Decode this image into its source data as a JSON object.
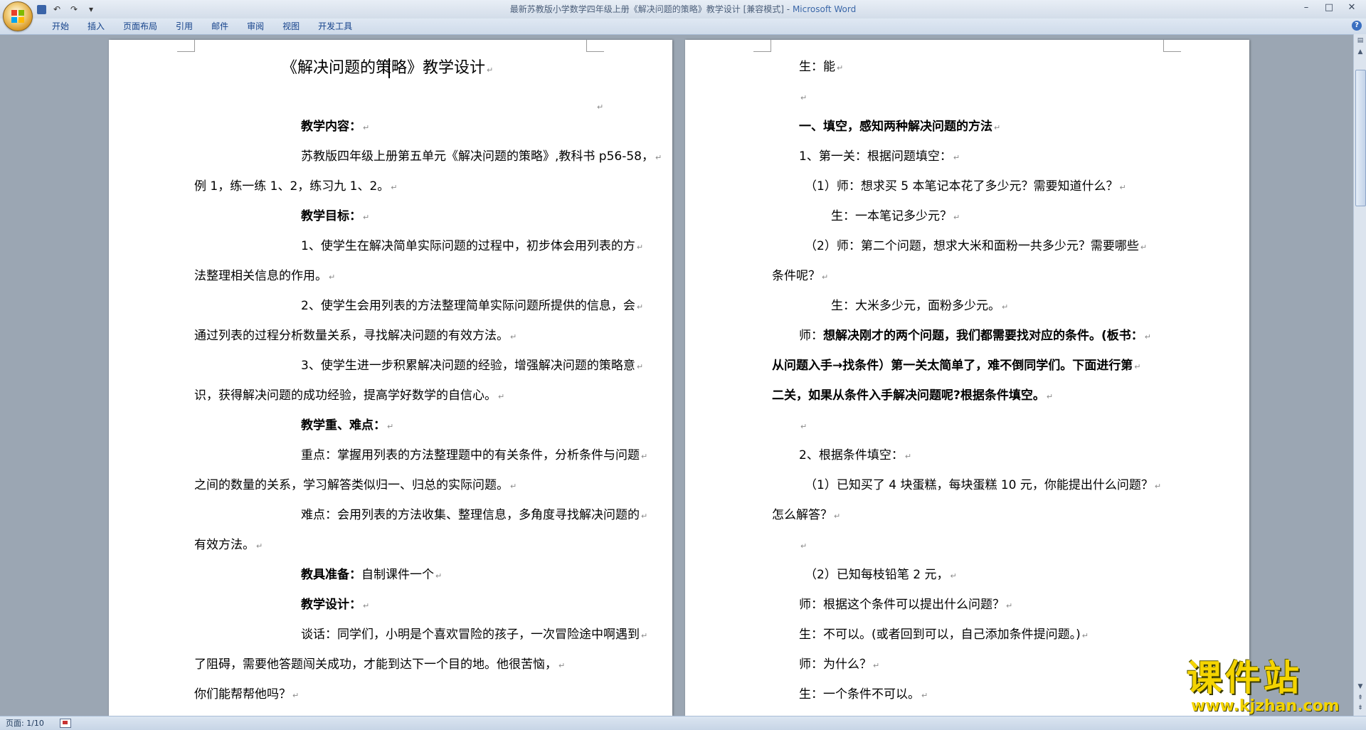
{
  "window": {
    "title": "最新苏教版小学数学四年级上册《解决问题的策略》教学设计 [兼容模式] -",
    "app_name": "Microsoft Word"
  },
  "quick_access": {
    "save_icon": "save-icon",
    "undo_icon": "undo-icon",
    "redo_icon": "redo-icon",
    "customize_icon": "dropdown-icon"
  },
  "ribbon": {
    "tabs": [
      "开始",
      "插入",
      "页面布局",
      "引用",
      "邮件",
      "审阅",
      "视图",
      "开发工具"
    ]
  },
  "page_left": {
    "heading": "《解决问题的策略》教学设计",
    "lines": [
      {
        "bold": "教学内容：",
        "text": ""
      },
      {
        "bold": "",
        "text": "苏教版四年级上册第五单元《解决问题的策略》,教科书 p56-58，"
      },
      {
        "bold": "",
        "text": "例 1，练一练 1、2，练习九 1、2。"
      },
      {
        "bold": "教学目标：",
        "text": ""
      },
      {
        "bold": "",
        "text": "1、使学生在解决简单实际问题的过程中，初步体会用列表的方"
      },
      {
        "bold": "",
        "text": "法整理相关信息的作用。"
      },
      {
        "bold": "",
        "text": "2、使学生会用列表的方法整理简单实际问题所提供的信息，会"
      },
      {
        "bold": "",
        "text": "通过列表的过程分析数量关系，寻找解决问题的有效方法。"
      },
      {
        "bold": "",
        "text": "3、使学生进一步积累解决问题的经验，增强解决问题的策略意"
      },
      {
        "bold": "",
        "text": "识，获得解决问题的成功经验，提高学好数学的自信心。"
      },
      {
        "bold": "教学重、难点：",
        "text": ""
      },
      {
        "bold": "",
        "text": "重点：掌握用列表的方法整理题中的有关条件，分析条件与问题"
      },
      {
        "bold": "",
        "text": "之间的数量的关系，学习解答类似归一、归总的实际问题。"
      },
      {
        "bold": "",
        "text": "难点：会用列表的方法收集、整理信息，多角度寻找解决问题的"
      },
      {
        "bold": "",
        "text": "有效方法。"
      },
      {
        "bold": "教具准备：",
        "text": "自制课件一个"
      },
      {
        "bold": "教学设计：",
        "text": ""
      },
      {
        "bold": "",
        "text": "谈话：同学们，小明是个喜欢冒险的孩子，一次冒险途中啊遇到"
      },
      {
        "bold": "",
        "text": "了阻碍，需要他答题闯关成功，才能到达下一个目的地。他很苦恼，"
      },
      {
        "bold": "",
        "text": "你们能帮帮他吗？"
      }
    ]
  },
  "page_right": {
    "lines": [
      {
        "bold": "",
        "text": "生：能"
      },
      {
        "bold": "",
        "text": ""
      },
      {
        "bold": "一、填空，感知两种解决问题的方法",
        "text": ""
      },
      {
        "bold": "",
        "text": "1、第一关：根据问题填空："
      },
      {
        "bold": "",
        "text": "（1）师：想求买 5 本笔记本花了多少元？需要知道什么？"
      },
      {
        "bold": "",
        "text": "生：一本笔记多少元？"
      },
      {
        "bold": "",
        "text": "（2）师：第二个问题，想求大米和面粉一共多少元？需要哪些"
      },
      {
        "bold": "",
        "text": "条件呢？"
      },
      {
        "bold": "",
        "text": "生：大米多少元，面粉多少元。"
      },
      {
        "bold": "想解决刚才的两个问题，我们都需要找对应的条件。(板书：",
        "text": "师："
      },
      {
        "bold": "从问题入手→找条件）第一关太简单了，难不倒同学们。下面进行第",
        "text": ""
      },
      {
        "bold": "二关，如果从条件入手解决问题呢?根据条件填空。",
        "text": ""
      },
      {
        "bold": "",
        "text": ""
      },
      {
        "bold": "",
        "text": "2、根据条件填空："
      },
      {
        "bold": "",
        "text": "（1）已知买了 4 块蛋糕，每块蛋糕 10 元，你能提出什么问题？"
      },
      {
        "bold": "",
        "text": "怎么解答？"
      },
      {
        "bold": "",
        "text": ""
      },
      {
        "bold": "",
        "text": "（2）已知每枝铅笔 2 元，"
      },
      {
        "bold": "",
        "text": "师：根据这个条件可以提出什么问题？"
      },
      {
        "bold": "",
        "text": "生：不可以。(或者回到可以，自己添加条件提问题。)"
      },
      {
        "bold": "",
        "text": "师：为什么？"
      },
      {
        "bold": "",
        "text": "生：一个条件不可以。"
      }
    ]
  },
  "status": {
    "page_label": "页面: 1/10"
  },
  "watermark": {
    "logo": "课件站",
    "url": "www.kjzhan.com"
  }
}
